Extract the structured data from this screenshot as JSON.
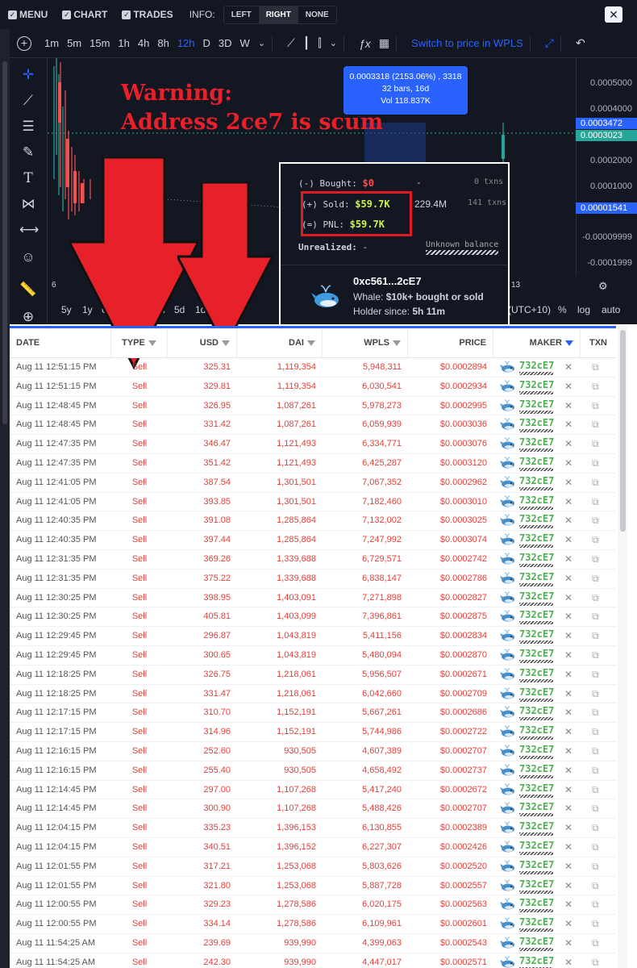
{
  "topbar": {
    "menu": "MENU",
    "chart": "CHART",
    "trades": "TRADES",
    "info_label": "INFO:",
    "info_left": "LEFT",
    "info_right": "RIGHT",
    "info_none": "NONE",
    "close": "✕"
  },
  "chart_toolbar": {
    "timeframes": [
      "1m",
      "5m",
      "15m",
      "1h",
      "4h",
      "8h",
      "12h",
      "D",
      "3D",
      "W"
    ],
    "active_timeframe": "12h",
    "switch_label": "Switch to price in WPLS"
  },
  "chart": {
    "warning_line1": "Warning:",
    "warning_line2": "Address 2ce7 is scum",
    "tooltip_line1": "0.0003318 (2153.06%) , 3318",
    "tooltip_line2": "32 bars, 16d",
    "tooltip_line3": "Vol 118.837K",
    "price_labels": [
      "0.0005000",
      "0.0004000",
      "0.0002000",
      "0.0001000",
      "-0.00009999",
      "-0.0001999"
    ],
    "price_tags": [
      "0.0003472",
      "0.0003023",
      "0.00001541"
    ],
    "axis_left": "6",
    "axis_right": "13",
    "ranges": [
      "5y",
      "1y",
      "6m",
      "1m",
      "5d",
      "1d"
    ],
    "tz": "(UTC+10)",
    "pct": "%",
    "log": "log",
    "auto": "auto"
  },
  "popup": {
    "bought_label": "(-) Bought:",
    "bought_value": "$0",
    "bought_dash": "-",
    "bought_txns": "0 txns",
    "sold_label": "(+) Sold:",
    "sold_value": "$59.7K",
    "sold_amount": "229.4M",
    "sold_txns": "141 txns",
    "pnl_label": "(=) PNL:",
    "pnl_value": "$59.7K",
    "unrealized_label": "Unrealized:",
    "unrealized_value": "-",
    "unknown_balance": "Unknown balance",
    "address": "0xc561...2cE7",
    "whale_label": "Whale:",
    "whale_desc": "$10k+ bought or sold",
    "holder_label": "Holder since:",
    "holder_since": "5h 11m"
  },
  "table": {
    "headers": {
      "date": "DATE",
      "type": "TYPE",
      "usd": "USD",
      "dai": "DAI",
      "wpls": "WPLS",
      "price": "PRICE",
      "maker": "MAKER",
      "txn": "TXN"
    },
    "rows": [
      {
        "date": "Aug 11 12:51:15 PM",
        "type": "Sell",
        "usd": "325.31",
        "dai": "1,119,354",
        "wpls": "5,948,311",
        "price": "$0.0002894",
        "maker": "732cE7"
      },
      {
        "date": "Aug 11 12:51:15 PM",
        "type": "Sell",
        "usd": "329.81",
        "dai": "1,119,354",
        "wpls": "6,030,541",
        "price": "$0.0002934",
        "maker": "732cE7"
      },
      {
        "date": "Aug 11 12:48:45 PM",
        "type": "Sell",
        "usd": "326.95",
        "dai": "1,087,261",
        "wpls": "5,978,273",
        "price": "$0.0002995",
        "maker": "732cE7"
      },
      {
        "date": "Aug 11 12:48:45 PM",
        "type": "Sell",
        "usd": "331.42",
        "dai": "1,087,261",
        "wpls": "6,059,939",
        "price": "$0.0003036",
        "maker": "732cE7"
      },
      {
        "date": "Aug 11 12:47:35 PM",
        "type": "Sell",
        "usd": "346.47",
        "dai": "1,121,493",
        "wpls": "6,334,771",
        "price": "$0.0003076",
        "maker": "732cE7"
      },
      {
        "date": "Aug 11 12:47:35 PM",
        "type": "Sell",
        "usd": "351.42",
        "dai": "1,121,493",
        "wpls": "6,425,287",
        "price": "$0.0003120",
        "maker": "732cE7"
      },
      {
        "date": "Aug 11 12:41:05 PM",
        "type": "Sell",
        "usd": "387.54",
        "dai": "1,301,501",
        "wpls": "7,067,352",
        "price": "$0.0002962",
        "maker": "732cE7"
      },
      {
        "date": "Aug 11 12:41:05 PM",
        "type": "Sell",
        "usd": "393.85",
        "dai": "1,301,501",
        "wpls": "7,182,460",
        "price": "$0.0003010",
        "maker": "732cE7"
      },
      {
        "date": "Aug 11 12:40:35 PM",
        "type": "Sell",
        "usd": "391.08",
        "dai": "1,285,864",
        "wpls": "7,132,002",
        "price": "$0.0003025",
        "maker": "732cE7"
      },
      {
        "date": "Aug 11 12:40:35 PM",
        "type": "Sell",
        "usd": "397.44",
        "dai": "1,285,864",
        "wpls": "7,247,992",
        "price": "$0.0003074",
        "maker": "732cE7"
      },
      {
        "date": "Aug 11 12:31:35 PM",
        "type": "Sell",
        "usd": "369.26",
        "dai": "1,339,688",
        "wpls": "6,729,571",
        "price": "$0.0002742",
        "maker": "732cE7"
      },
      {
        "date": "Aug 11 12:31:35 PM",
        "type": "Sell",
        "usd": "375.22",
        "dai": "1,339,688",
        "wpls": "6,838,147",
        "price": "$0.0002786",
        "maker": "732cE7"
      },
      {
        "date": "Aug 11 12:30:25 PM",
        "type": "Sell",
        "usd": "398.95",
        "dai": "1,403,091",
        "wpls": "7,271,898",
        "price": "$0.0002827",
        "maker": "732cE7"
      },
      {
        "date": "Aug 11 12:30:25 PM",
        "type": "Sell",
        "usd": "405.81",
        "dai": "1,403,099",
        "wpls": "7,396,861",
        "price": "$0.0002875",
        "maker": "732cE7"
      },
      {
        "date": "Aug 11 12:29:45 PM",
        "type": "Sell",
        "usd": "296.87",
        "dai": "1,043,819",
        "wpls": "5,411,156",
        "price": "$0.0002834",
        "maker": "732cE7"
      },
      {
        "date": "Aug 11 12:29:45 PM",
        "type": "Sell",
        "usd": "300.65",
        "dai": "1,043,819",
        "wpls": "5,480,094",
        "price": "$0.0002870",
        "maker": "732cE7"
      },
      {
        "date": "Aug 11 12:18:25 PM",
        "type": "Sell",
        "usd": "326.75",
        "dai": "1,218,061",
        "wpls": "5,956,507",
        "price": "$0.0002671",
        "maker": "732cE7"
      },
      {
        "date": "Aug 11 12:18:25 PM",
        "type": "Sell",
        "usd": "331.47",
        "dai": "1,218,061",
        "wpls": "6,042,660",
        "price": "$0.0002709",
        "maker": "732cE7"
      },
      {
        "date": "Aug 11 12:17:15 PM",
        "type": "Sell",
        "usd": "310.70",
        "dai": "1,152,191",
        "wpls": "5,667,261",
        "price": "$0.0002686",
        "maker": "732cE7"
      },
      {
        "date": "Aug 11 12:17:15 PM",
        "type": "Sell",
        "usd": "314.96",
        "dai": "1,152,191",
        "wpls": "5,744,986",
        "price": "$0.0002722",
        "maker": "732cE7"
      },
      {
        "date": "Aug 11 12:16:15 PM",
        "type": "Sell",
        "usd": "252.60",
        "dai": "930,505",
        "wpls": "4,607,389",
        "price": "$0.0002707",
        "maker": "732cE7"
      },
      {
        "date": "Aug 11 12:16:15 PM",
        "type": "Sell",
        "usd": "255.40",
        "dai": "930,505",
        "wpls": "4,658,492",
        "price": "$0.0002737",
        "maker": "732cE7"
      },
      {
        "date": "Aug 11 12:14:45 PM",
        "type": "Sell",
        "usd": "297.00",
        "dai": "1,107,268",
        "wpls": "5,417,240",
        "price": "$0.0002672",
        "maker": "732cE7"
      },
      {
        "date": "Aug 11 12:14:45 PM",
        "type": "Sell",
        "usd": "300.90",
        "dai": "1,107,268",
        "wpls": "5,488,426",
        "price": "$0.0002707",
        "maker": "732cE7"
      },
      {
        "date": "Aug 11 12:04:15 PM",
        "type": "Sell",
        "usd": "335.23",
        "dai": "1,396,153",
        "wpls": "6,130,855",
        "price": "$0.0002389",
        "maker": "732cE7"
      },
      {
        "date": "Aug 11 12:04:15 PM",
        "type": "Sell",
        "usd": "340.51",
        "dai": "1,396,152",
        "wpls": "6,227,307",
        "price": "$0.0002426",
        "maker": "732cE7"
      },
      {
        "date": "Aug 11 12:01:55 PM",
        "type": "Sell",
        "usd": "317.21",
        "dai": "1,253,068",
        "wpls": "5,803,626",
        "price": "$0.0002520",
        "maker": "732cE7"
      },
      {
        "date": "Aug 11 12:01:55 PM",
        "type": "Sell",
        "usd": "321.80",
        "dai": "1,253,068",
        "wpls": "5,887,728",
        "price": "$0.0002557",
        "maker": "732cE7"
      },
      {
        "date": "Aug 11 12:00:55 PM",
        "type": "Sell",
        "usd": "329.23",
        "dai": "1,278,586",
        "wpls": "6,020,175",
        "price": "$0.0002563",
        "maker": "732cE7"
      },
      {
        "date": "Aug 11 12:00:55 PM",
        "type": "Sell",
        "usd": "334.14",
        "dai": "1,278,586",
        "wpls": "6,109,961",
        "price": "$0.0002601",
        "maker": "732cE7"
      },
      {
        "date": "Aug 11 11:54:25 AM",
        "type": "Sell",
        "usd": "239.69",
        "dai": "939,990",
        "wpls": "4,399,063",
        "price": "$0.0002543",
        "maker": "732cE7"
      },
      {
        "date": "Aug 11 11:54:25 AM",
        "type": "Sell",
        "usd": "242.30",
        "dai": "939,990",
        "wpls": "4,447,017",
        "price": "$0.0002571",
        "maker": "732cE7"
      }
    ]
  },
  "colors": {
    "sell": "#e2403a",
    "accent": "#2962ff",
    "warning": "#e8202a",
    "pnl": "#c8f542"
  },
  "icons": [
    "plus-circle-icon",
    "crosshair-icon",
    "trend-line-icon",
    "fib-icon",
    "brush-icon",
    "text-icon",
    "pattern-icon",
    "measure-icon",
    "emoji-icon",
    "ruler-icon",
    "zoom-icon",
    "filter-icon",
    "whale-icon",
    "external-link-icon",
    "close-icon"
  ]
}
